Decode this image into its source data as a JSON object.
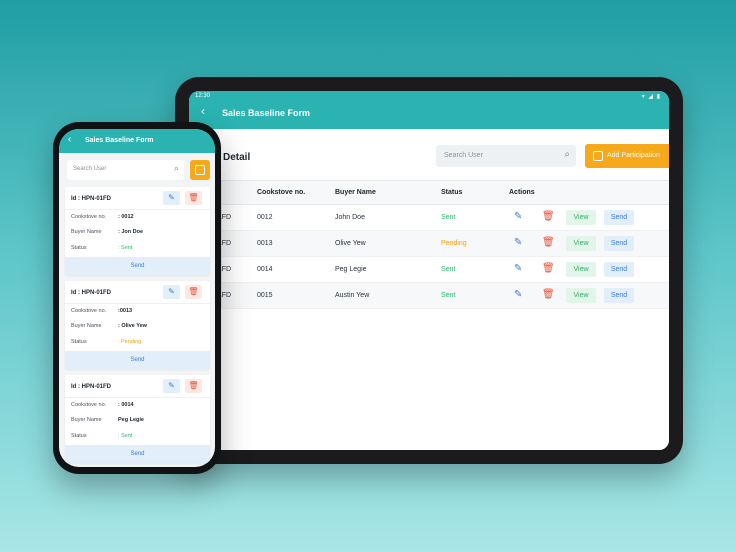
{
  "tablet": {
    "status_time": "12:30",
    "status_icons": "▾ ◢ ▮",
    "header_title": "Sales Baseline Form",
    "page_heading": "Detail",
    "search_placeholder": "Search User",
    "add_button": "Add Participation",
    "columns": [
      "",
      "Cookstove no.",
      "Buyer Name",
      "Status",
      "Actions"
    ],
    "rows": [
      {
        "id": "01FD",
        "cookstove": "0012",
        "buyer": "John Doe",
        "status": "Sent"
      },
      {
        "id": "01FD",
        "cookstove": "0013",
        "buyer": "Olive Yew",
        "status": "Pending"
      },
      {
        "id": "01FD",
        "cookstove": "0014",
        "buyer": "Peg Legie",
        "status": "Sent"
      },
      {
        "id": "01FD",
        "cookstove": "0015",
        "buyer": "Austin Yew",
        "status": "Sent"
      }
    ],
    "view_label": "View",
    "send_label": "Send"
  },
  "phone": {
    "header_title": "Sales Baseline Form",
    "search_placeholder": "Search User",
    "labels": {
      "cookstove": "Cookstove no.",
      "buyer": "Buyer Name",
      "status": "Status"
    },
    "send_label": "Send",
    "cards": [
      {
        "id": "Id : HPN-01FD",
        "cookstove": ": 0012",
        "buyer": ": Jon Doe",
        "status": ": Sent"
      },
      {
        "id": "Id : HPN-01FD",
        "cookstove": ":0013",
        "buyer": ": Olive Yew",
        "status": ": Pending"
      },
      {
        "id": "Id : HPN-01FD",
        "cookstove": ": 0014",
        "buyer": "Peg Legie",
        "status": ": Sent"
      }
    ]
  },
  "colors": {
    "primary": "#2ab3b1",
    "accent": "#f6a91a",
    "sent": "#2db86c",
    "pending": "#f2a413",
    "edit": "#3c7bd6",
    "delete": "#e2553f"
  },
  "icons": [
    "back-arrow-icon",
    "search-icon",
    "add-document-icon",
    "edit-icon",
    "trash-icon",
    "filter-icon"
  ]
}
